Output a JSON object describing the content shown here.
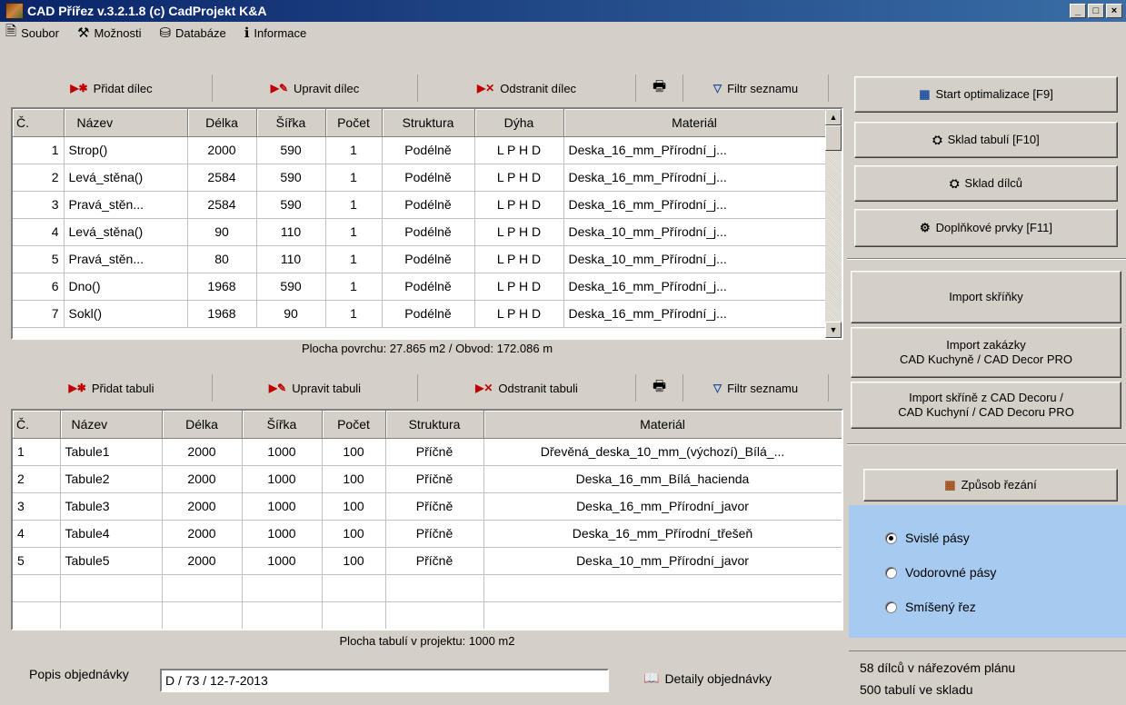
{
  "window": {
    "title": "CAD Přířez v.3.2.1.8  (c) CadProjekt K&A",
    "min": "_",
    "max": "□",
    "close": "×"
  },
  "menu": [
    {
      "icon": "file-icon",
      "glyph": "🗎",
      "label": "Soubor"
    },
    {
      "icon": "tools-icon",
      "glyph": "⚒",
      "label": "Možnosti"
    },
    {
      "icon": "database-icon",
      "glyph": "⛁",
      "label": "Databáze"
    },
    {
      "icon": "info-icon",
      "glyph": "ℹ",
      "label": "Informace"
    }
  ],
  "parts_toolbar": {
    "add": "Přidat dílec",
    "edit": "Upravit dílec",
    "remove": "Odstranit dílec",
    "filter": "Filtr seznamu"
  },
  "parts_table": {
    "headers": [
      "Č.",
      "Název",
      "Délka",
      "Šířka",
      "Počet",
      "Struktura",
      "Dýha",
      "Materiál"
    ],
    "rows": [
      [
        "1",
        "Strop()",
        "2000",
        "590",
        "1",
        "Podélně",
        "L P H D",
        "Deska_16_mm_Přírodní_j..."
      ],
      [
        "2",
        "Levá_stěna()",
        "2584",
        "590",
        "1",
        "Podélně",
        "L P H D",
        "Deska_16_mm_Přírodní_j..."
      ],
      [
        "3",
        "Pravá_stěn...",
        "2584",
        "590",
        "1",
        "Podélně",
        "L P H D",
        "Deska_16_mm_Přírodní_j..."
      ],
      [
        "4",
        "Levá_stěna()",
        "90",
        "110",
        "1",
        "Podélně",
        "L P H D",
        "Deska_10_mm_Přírodní_j..."
      ],
      [
        "5",
        "Pravá_stěn...",
        "80",
        "110",
        "1",
        "Podélně",
        "L P H D",
        "Deska_10_mm_Přírodní_j..."
      ],
      [
        "6",
        "Dno()",
        "1968",
        "590",
        "1",
        "Podélně",
        "L P H D",
        "Deska_16_mm_Přírodní_j..."
      ],
      [
        "7",
        "Sokl()",
        "1968",
        "90",
        "1",
        "Podélně",
        "L P H D",
        "Deska_16_mm_Přírodní_j..."
      ]
    ]
  },
  "parts_status": "Plocha povrchu: 27.865 m2 / Obvod: 172.086 m",
  "sheets_toolbar": {
    "add": "Přidat tabuli",
    "edit": "Upravit tabuli",
    "remove": "Odstranit tabuli",
    "filter": "Filtr seznamu"
  },
  "sheets_table": {
    "headers": [
      "Č.",
      "Název",
      "Délka",
      "Šířka",
      "Počet",
      "Struktura",
      "Materiál"
    ],
    "rows": [
      [
        "1",
        "Tabule1",
        "2000",
        "1000",
        "100",
        "Příčně",
        "Dřevěná_deska_10_mm_(výchozí)_Bílá_..."
      ],
      [
        "2",
        "Tabule2",
        "2000",
        "1000",
        "100",
        "Příčně",
        "Deska_16_mm_Bílá_hacienda"
      ],
      [
        "3",
        "Tabule3",
        "2000",
        "1000",
        "100",
        "Příčně",
        "Deska_16_mm_Přírodní_javor"
      ],
      [
        "4",
        "Tabule4",
        "2000",
        "1000",
        "100",
        "Příčně",
        "Deska_16_mm_Přírodní_třešeň"
      ],
      [
        "5",
        "Tabule5",
        "2000",
        "1000",
        "100",
        "Příčně",
        "Deska_10_mm_Přírodní_javor"
      ],
      [
        "",
        "",
        "",
        "",
        "",
        "",
        ""
      ],
      [
        "",
        "",
        "",
        "",
        "",
        "",
        ""
      ]
    ]
  },
  "sheets_status": "Plocha tabulí v projektu: 1000 m2",
  "right_panel": {
    "start": "Start optimalizace [F9]",
    "sheet_stock": "Sklad tabulí [F10]",
    "part_stock": "Sklad dílců",
    "accessories": "Doplňkové prvky [F11]",
    "import_cabinet": "Import skříňky",
    "import_order_line1": "Import zakázky",
    "import_order_line2": "CAD Kuchyně / CAD Decor PRO",
    "import_decor_line1": "Import skříně z CAD Decoru /",
    "import_decor_line2": "CAD Kuchyní / CAD Decoru PRO",
    "cut_method": "Způsob řezání",
    "cut_options": [
      {
        "label": "Svislé pásy",
        "selected": true
      },
      {
        "label": "Vodorovné pásy",
        "selected": false
      },
      {
        "label": "Smíšený řez",
        "selected": false
      }
    ]
  },
  "bottom": {
    "order_label": "Popis objednávky",
    "order_value": "D / 73 / 12-7-2013",
    "details": "Detaily objednávky"
  },
  "status": {
    "line1": "58 dílců v nářezovém plánu",
    "line2": "500 tabulí ve skladu"
  },
  "colors": {
    "titlebar": "#0a246a",
    "panel": "#d4d0c8",
    "radio_panel": "#a6caf0",
    "accent_red": "#c00000"
  }
}
